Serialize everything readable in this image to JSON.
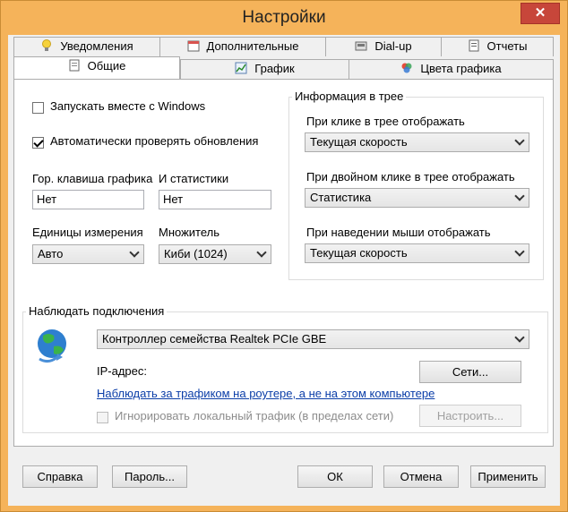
{
  "window": {
    "title": "Настройки",
    "close_glyph": "✕"
  },
  "tabs_row1": [
    {
      "label": "Уведомления",
      "icon": "lightbulb-icon"
    },
    {
      "label": "Дополнительные",
      "icon": "calendar-icon"
    },
    {
      "label": "Dial-up",
      "icon": "modem-icon"
    },
    {
      "label": "Отчеты",
      "icon": "report-icon"
    }
  ],
  "tabs_row2": [
    {
      "label": "Общие",
      "icon": "settings-doc-icon",
      "active": true
    },
    {
      "label": "График",
      "icon": "graph-icon"
    },
    {
      "label": "Цвета графика",
      "icon": "palette-icon"
    }
  ],
  "general": {
    "run_with_windows": {
      "label": "Запускать вместе с Windows",
      "checked": false
    },
    "auto_update": {
      "label": "Автоматически проверять обновления",
      "checked": true
    },
    "hotkey_graph": {
      "label": "Гор. клавиша графика",
      "value": "Нет"
    },
    "hotkey_stats": {
      "label": "И статистики",
      "value": "Нет"
    },
    "units": {
      "label": "Единицы измерения",
      "value": "Авто"
    },
    "multiplier": {
      "label": "Множитель",
      "value": "Киби (1024)"
    }
  },
  "tray": {
    "legend": "Информация в трее",
    "click_label": "При клике в трее отображать",
    "click_value": "Текущая скорость",
    "dblclick_label": "При двойном клике в трее отображать",
    "dblclick_value": "Статистика",
    "hover_label": "При наведении мыши отображать",
    "hover_value": "Текущая скорость"
  },
  "monitor": {
    "legend": "Наблюдать подключения",
    "adapter": "Контроллер семейства Realtek PCIe GBE",
    "ip_label": "IP-адрес:",
    "networks_button": "Сети...",
    "router_link": "Наблюдать за трафиком на роутере, а не на этом компьютере",
    "ignore_local": {
      "label": "Игнорировать локальный трафик (в пределах сети)",
      "checked": false,
      "enabled": false
    },
    "configure_button": "Настроить..."
  },
  "footer": {
    "help": "Справка",
    "password": "Пароль...",
    "ok": "ОК",
    "cancel": "Отмена",
    "apply": "Применить"
  },
  "colors": {
    "title_bar": "#f5b35a",
    "close_button": "#c7463a",
    "link": "#0b3ea8"
  }
}
